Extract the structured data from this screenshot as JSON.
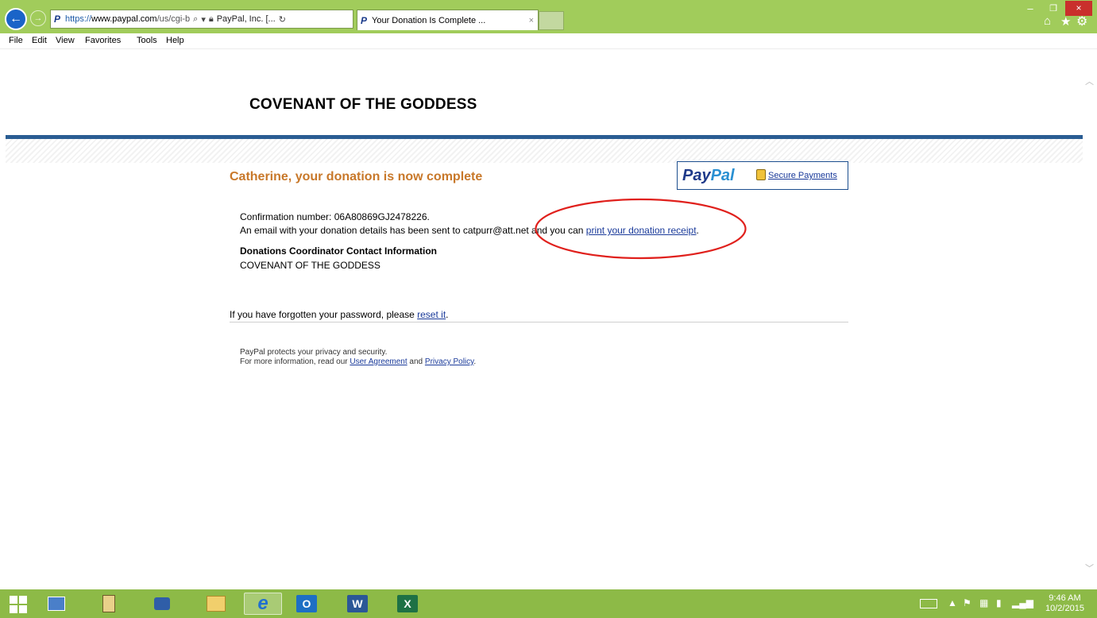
{
  "browser": {
    "address_url_scheme": "https://",
    "address_url_domain": "www.paypal.com",
    "address_url_path": "/us/cgi-b",
    "address_search_icon": "search-icon",
    "address_cert": "PayPal, Inc. [...",
    "address_refresh_icon": "refresh-icon",
    "tab_title": "Your Donation Is Complete ...",
    "tab_close": "×",
    "menu": [
      "File",
      "Edit",
      "View",
      "Favorites",
      "Tools",
      "Help"
    ],
    "minimize": "–",
    "maximize": "❐",
    "close": "×",
    "accent": "#a1cc5b"
  },
  "page": {
    "site_title": "COVENANT OF THE GODDESS",
    "headline": "Catherine, your donation is now complete",
    "paypal_logo_1": "Pay",
    "paypal_logo_2": "Pal",
    "secure_payments": "Secure Payments",
    "confirmation": "Confirmation number: 06A80869GJ2478226.",
    "email_prefix": "An email with your donation details has been sent to catpurr@att.net and you can ",
    "email_link": "print your donation receipt",
    "email_suffix": ".",
    "coordinator_title": "Donations Coordinator Contact Information",
    "coordinator_name": "COVENANT OF THE GODDESS",
    "forgot_prefix": "If you have forgotten your password, please ",
    "forgot_link": "reset it",
    "forgot_suffix": ".",
    "privacy_line1": "PayPal protects your privacy and security.",
    "privacy_prefix": "For more information, read our ",
    "user_agreement": "User Agreement",
    "privacy_and": " and ",
    "privacy_policy": "Privacy Policy",
    "privacy_suffix": ".",
    "headline_color": "#c8782a",
    "rule_color": "#2a5d93"
  },
  "taskbar": {
    "time": "9:46 AM",
    "date": "10/2/2015",
    "apps": [
      "control-panel-icon",
      "file-explorer-icon",
      "network-icon",
      "library-icon",
      "internet-explorer-icon",
      "outlook-icon",
      "word-icon",
      "excel-icon"
    ],
    "outlook_label": "O",
    "word_label": "W",
    "excel_label": "X"
  }
}
